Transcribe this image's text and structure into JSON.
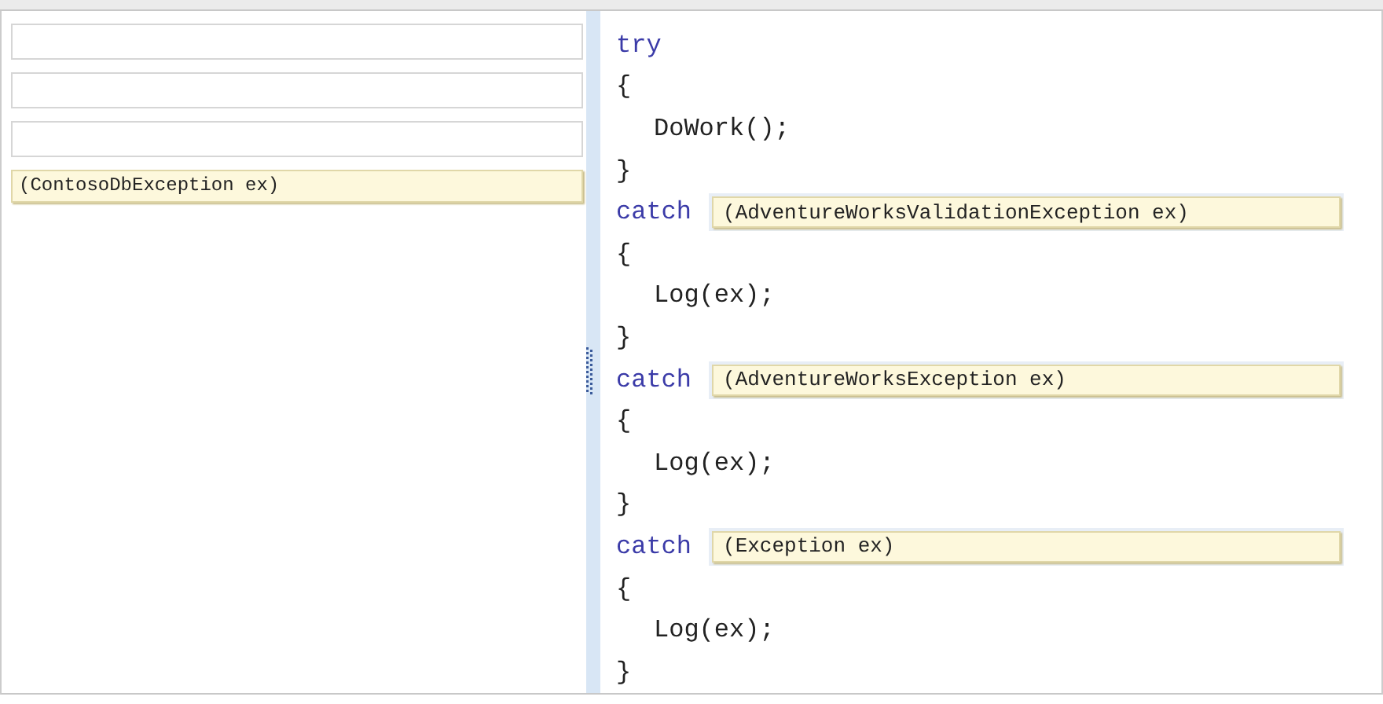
{
  "answer_choices": [
    {
      "kind": "empty"
    },
    {
      "kind": "empty"
    },
    {
      "kind": "empty"
    },
    {
      "kind": "tile",
      "text": "(ContosoDbException ex)"
    }
  ],
  "code_lines": [
    {
      "kind": "keyword",
      "text": "try"
    },
    {
      "kind": "brace",
      "text": "{"
    },
    {
      "kind": "statement",
      "text": "DoWork();"
    },
    {
      "kind": "brace",
      "text": "}"
    },
    {
      "kind": "catch",
      "text": "catch",
      "answer": "(AdventureWorksValidationException ex)"
    },
    {
      "kind": "brace",
      "text": "{"
    },
    {
      "kind": "statement",
      "text": "Log(ex);"
    },
    {
      "kind": "brace",
      "text": "}"
    },
    {
      "kind": "catch",
      "text": "catch",
      "answer": "(AdventureWorksException ex)"
    },
    {
      "kind": "brace",
      "text": "{"
    },
    {
      "kind": "statement",
      "text": "Log(ex);"
    },
    {
      "kind": "brace",
      "text": "}"
    },
    {
      "kind": "catch",
      "text": "catch",
      "answer": "(Exception ex)"
    },
    {
      "kind": "brace",
      "text": "{"
    },
    {
      "kind": "statement",
      "text": "Log(ex);"
    },
    {
      "kind": "brace",
      "text": "}"
    }
  ]
}
